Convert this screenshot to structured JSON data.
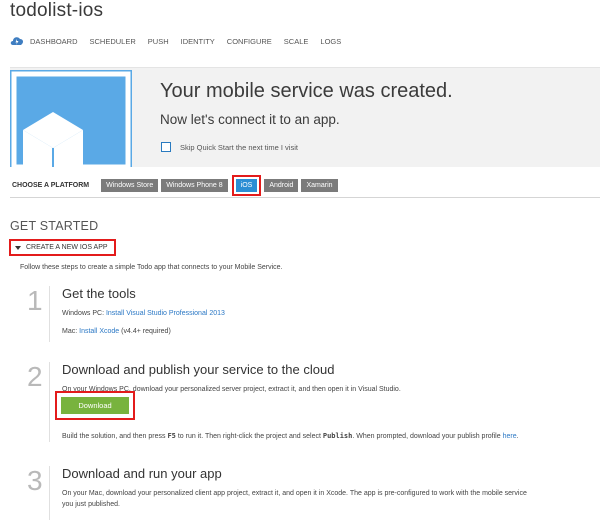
{
  "app_title": "todolist-ios",
  "nav": [
    "DASHBOARD",
    "SCHEDULER",
    "PUSH",
    "IDENTITY",
    "CONFIGURE",
    "SCALE",
    "LOGS"
  ],
  "banner": {
    "headline": "Your mobile service was created.",
    "sub": "Now let's connect it to an app.",
    "skip_label": "Skip Quick Start the next time I visit"
  },
  "platform": {
    "label": "CHOOSE A PLATFORM",
    "options": [
      "Windows Store",
      "Windows Phone 8",
      "iOS",
      "Android",
      "Xamarin"
    ],
    "selected": "iOS"
  },
  "get_started": "GET STARTED",
  "create_section": "CREATE A NEW IOS APP",
  "intro": "Follow these steps to create a simple Todo app that connects to your Mobile Service.",
  "steps": [
    {
      "num": "1",
      "title": "Get the tools",
      "line1_prefix": "Windows PC: ",
      "line1_link": "Install Visual Studio Professional 2013",
      "line2_prefix": "Mac: ",
      "line2_link": "Install Xcode",
      "line2_suffix": " (v4.4+ required)"
    },
    {
      "num": "2",
      "title": "Download and publish your service to the cloud",
      "desc": "On your Windows PC, download your personalized server project, extract it, and then open it in Visual Studio.",
      "button": "Download",
      "after_1": "Build the solution, and then press ",
      "after_code1": "F5",
      "after_2": " to run it. Then right-click the project and select ",
      "after_code2": "Publish",
      "after_3": ". When prompted, download your publish profile ",
      "after_link": "here",
      "after_4": "."
    },
    {
      "num": "3",
      "title": "Download and run your app",
      "desc1": "On your Mac, download your personalized client app project, extract it, and open it in Xcode. The app is pre-configured to work with the mobile service",
      "desc2": "you just published."
    }
  ],
  "colors": {
    "accent_blue": "#2c8ed4",
    "tile_blue": "#5aa9e6",
    "download_green": "#78b33e",
    "highlight_red": "#e31b1b"
  }
}
